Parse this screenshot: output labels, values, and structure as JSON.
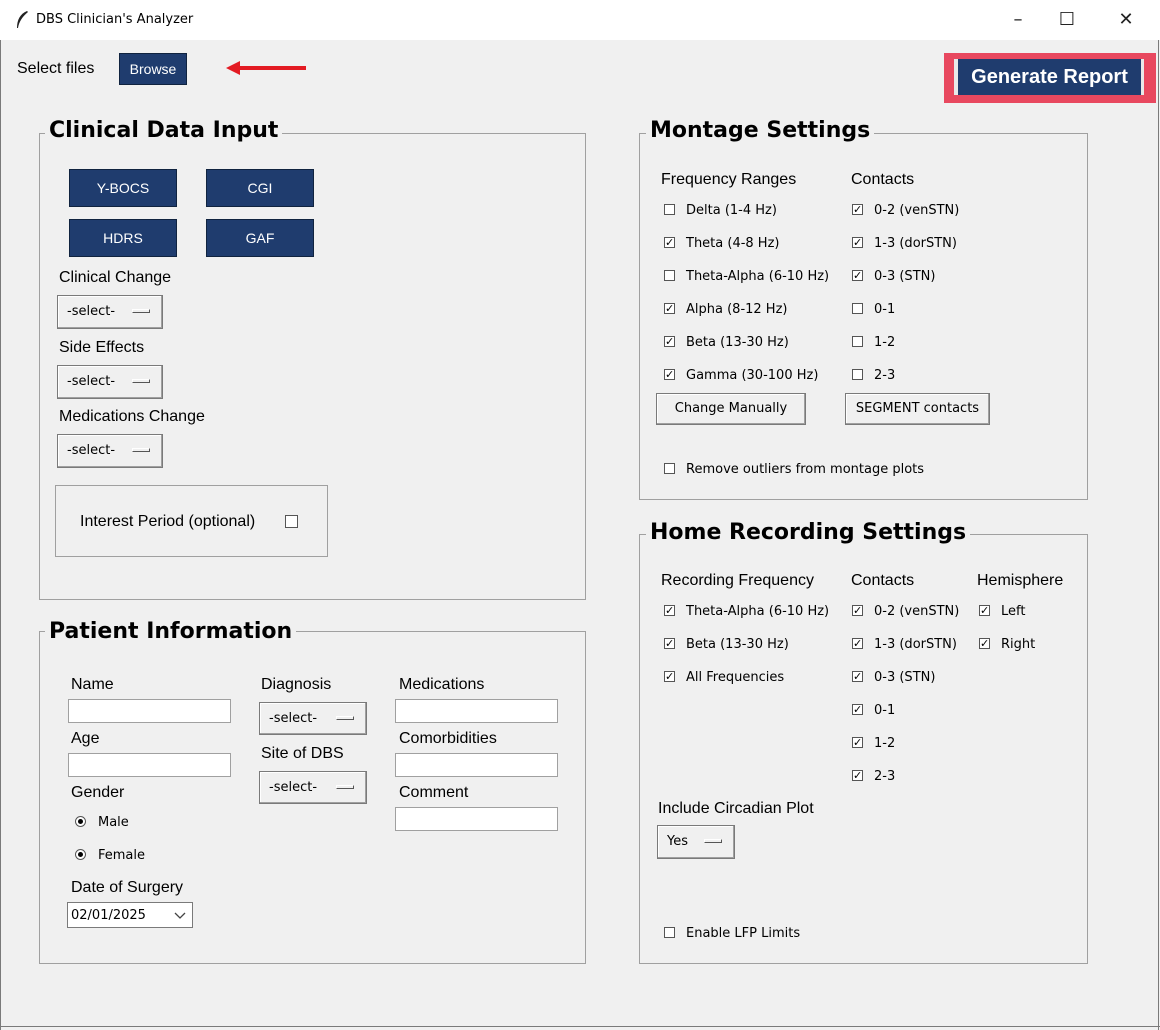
{
  "window": {
    "title": "DBS Clinician's Analyzer",
    "minimize": "–",
    "maximize": "☐",
    "close": "✕"
  },
  "toolbar": {
    "select_files_label": "Select files",
    "browse_label": "Browse",
    "generate_report_label": "Generate Report"
  },
  "clinical": {
    "title": "Clinical Data Input",
    "buttons": [
      "Y-BOCS",
      "CGI",
      "HDRS",
      "GAF"
    ],
    "clinical_change_label": "Clinical Change",
    "clinical_change_value": "-select-",
    "side_effects_label": "Side Effects",
    "side_effects_value": "-select-",
    "medications_change_label": "Medications Change",
    "medications_change_value": "-select-",
    "interest_period_label": "Interest Period (optional)"
  },
  "patient": {
    "title": "Patient Information",
    "name_label": "Name",
    "age_label": "Age",
    "gender_label": "Gender",
    "male_label": "Male",
    "female_label": "Female",
    "date_of_surgery_label": "Date of Surgery",
    "date_of_surgery_value": "02/01/2025",
    "diagnosis_label": "Diagnosis",
    "diagnosis_value": "-select-",
    "site_label": "Site of DBS",
    "site_value": "-select-",
    "medications_label": "Medications",
    "comorbidities_label": "Comorbidities",
    "comment_label": "Comment"
  },
  "montage": {
    "title": "Montage Settings",
    "freq_header": "Frequency Ranges",
    "contacts_header": "Contacts",
    "frequencies": [
      {
        "label": "Delta (1-4 Hz)",
        "checked": false
      },
      {
        "label": "Theta (4-8 Hz)",
        "checked": true
      },
      {
        "label": "Theta-Alpha (6-10 Hz)",
        "checked": false
      },
      {
        "label": "Alpha (8-12 Hz)",
        "checked": true
      },
      {
        "label": "Beta (13-30 Hz)",
        "checked": true
      },
      {
        "label": "Gamma (30-100 Hz)",
        "checked": true
      }
    ],
    "contacts": [
      {
        "label": "0-2 (venSTN)",
        "checked": true
      },
      {
        "label": "1-3 (dorSTN)",
        "checked": true
      },
      {
        "label": "0-3 (STN)",
        "checked": true
      },
      {
        "label": "0-1",
        "checked": false
      },
      {
        "label": "1-2",
        "checked": false
      },
      {
        "label": "2-3",
        "checked": false
      }
    ],
    "change_manually_label": "Change Manually",
    "segment_contacts_label": "SEGMENT contacts",
    "remove_outliers_label": "Remove outliers from montage plots"
  },
  "home": {
    "title": "Home Recording Settings",
    "freq_header": "Recording Frequency",
    "contacts_header": "Contacts",
    "hemisphere_header": "Hemisphere",
    "frequencies": [
      {
        "label": "Theta-Alpha (6-10 Hz)",
        "checked": true
      },
      {
        "label": "Beta (13-30 Hz)",
        "checked": true
      },
      {
        "label": "All Frequencies",
        "checked": true
      }
    ],
    "contacts": [
      {
        "label": "0-2 (venSTN)",
        "checked": true
      },
      {
        "label": "1-3 (dorSTN)",
        "checked": true
      },
      {
        "label": "0-3 (STN)",
        "checked": true
      },
      {
        "label": "0-1",
        "checked": true
      },
      {
        "label": "1-2",
        "checked": true
      },
      {
        "label": "2-3",
        "checked": true
      }
    ],
    "hemispheres": [
      {
        "label": "Left",
        "checked": true
      },
      {
        "label": "Right",
        "checked": true
      }
    ],
    "circadian_label": "Include Circadian Plot",
    "circadian_value": "Yes",
    "lfp_limits_label": "Enable LFP Limits"
  },
  "colors": {
    "button_blue": "#1f3c6e",
    "highlight_red": "#e8485f",
    "arrow_red": "#e31b23"
  }
}
